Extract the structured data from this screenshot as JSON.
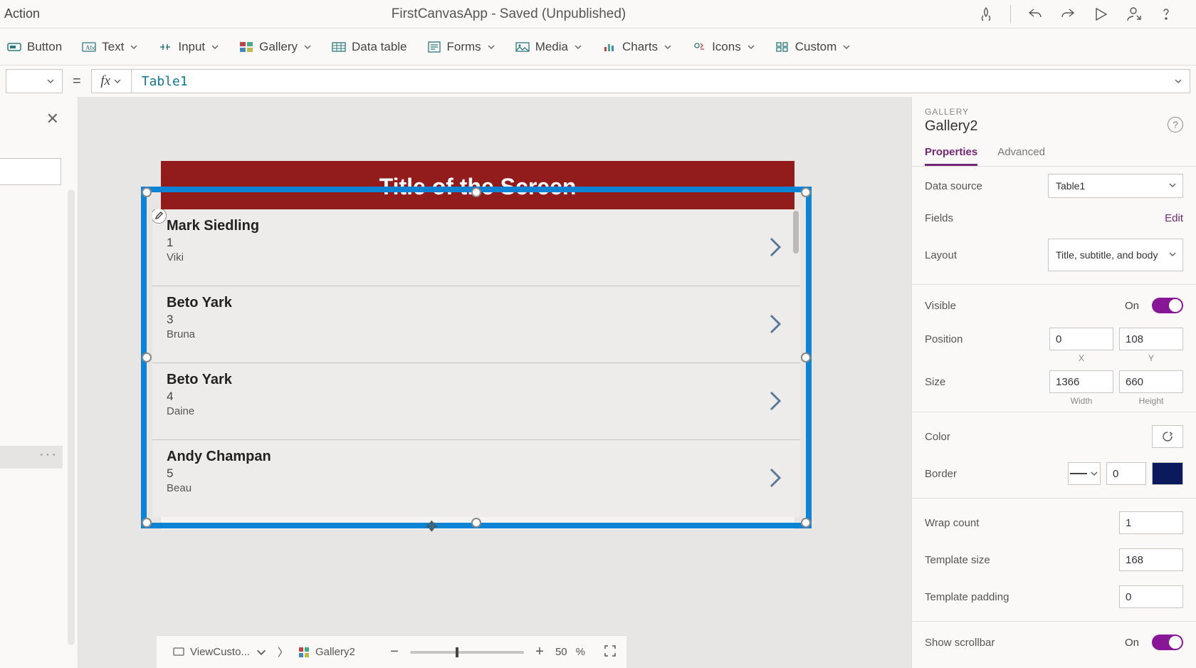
{
  "titlebar": {
    "action_label": "Action",
    "center_title": "FirstCanvasApp - Saved (Unpublished)"
  },
  "ribbon": {
    "button": "Button",
    "text": "Text",
    "input": "Input",
    "gallery": "Gallery",
    "data_table": "Data table",
    "forms": "Forms",
    "media": "Media",
    "charts": "Charts",
    "icons": "Icons",
    "custom": "Custom"
  },
  "formula": {
    "fx": "fx",
    "value": "Table1"
  },
  "canvas": {
    "screen_title": "Title of the Screen",
    "gallery_items": [
      {
        "title": "Mark Siedling",
        "sub": "1",
        "body": "Viki"
      },
      {
        "title": "Beto Yark",
        "sub": "3",
        "body": "Bruna"
      },
      {
        "title": "Beto Yark",
        "sub": "4",
        "body": "Daine"
      },
      {
        "title": "Andy Champan",
        "sub": "5",
        "body": "Beau"
      }
    ]
  },
  "footer": {
    "breadcrumb_screen": "ViewCusto...",
    "breadcrumb_control": "Gallery2",
    "zoom_value": "50",
    "zoom_unit": "%"
  },
  "panel": {
    "category": "GALLERY",
    "name": "Gallery2",
    "tab_properties": "Properties",
    "tab_advanced": "Advanced",
    "labels": {
      "data_source": "Data source",
      "fields": "Fields",
      "layout": "Layout",
      "visible": "Visible",
      "position": "Position",
      "size": "Size",
      "color": "Color",
      "border": "Border",
      "wrap_count": "Wrap count",
      "template_size": "Template size",
      "template_padding": "Template padding",
      "show_scrollbar": "Show scrollbar",
      "x": "X",
      "y": "Y",
      "width": "Width",
      "height": "Height",
      "edit": "Edit",
      "on": "On"
    },
    "values": {
      "data_source": "Table1",
      "layout": "Title, subtitle, and body",
      "pos_x": "0",
      "pos_y": "108",
      "size_w": "1366",
      "size_h": "660",
      "border_w": "0",
      "wrap_count": "1",
      "template_size": "168",
      "template_padding": "0"
    }
  }
}
